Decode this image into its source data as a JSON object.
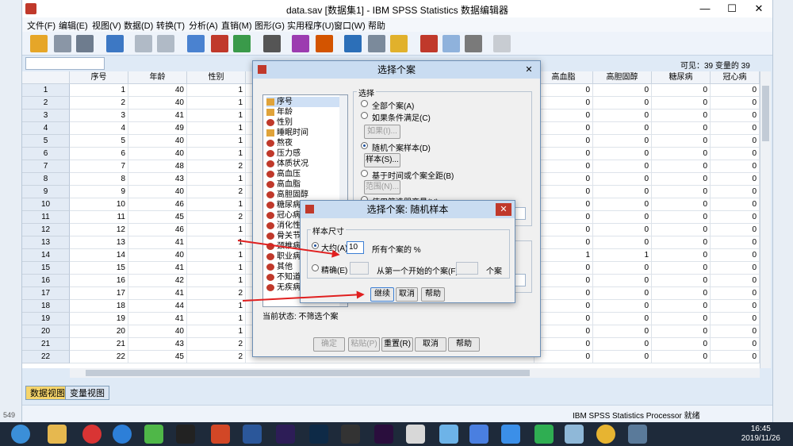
{
  "window": {
    "title": "data.sav [数据集1] - IBM SPSS Statistics 数据编辑器",
    "minimize": "—",
    "maximize": "☐",
    "close": "✕"
  },
  "menu": [
    "文件(F)",
    "编辑(E)",
    "视图(V)",
    "数据(D)",
    "转换(T)",
    "分析(A)",
    "直销(M)",
    "图形(G)",
    "实用程序(U)",
    "窗口(W)",
    "帮助"
  ],
  "visible_info": "可见：39 变量的 39",
  "columns": [
    "序号",
    "年龄",
    "性别",
    "高血脂",
    "高胆固醇",
    "糖尿病",
    "冠心病"
  ],
  "rows": [
    {
      "n": "1",
      "id": "1",
      "age": "40",
      "sex": "1",
      "hl": "0",
      "hc": "0",
      "db": "0",
      "chd": "0"
    },
    {
      "n": "2",
      "id": "2",
      "age": "40",
      "sex": "1",
      "hl": "0",
      "hc": "0",
      "db": "0",
      "chd": "0"
    },
    {
      "n": "3",
      "id": "3",
      "age": "41",
      "sex": "1",
      "hl": "0",
      "hc": "0",
      "db": "0",
      "chd": "0"
    },
    {
      "n": "4",
      "id": "4",
      "age": "49",
      "sex": "1",
      "hl": "0",
      "hc": "0",
      "db": "0",
      "chd": "0"
    },
    {
      "n": "5",
      "id": "5",
      "age": "40",
      "sex": "1",
      "hl": "0",
      "hc": "0",
      "db": "0",
      "chd": "0"
    },
    {
      "n": "6",
      "id": "6",
      "age": "40",
      "sex": "1",
      "hl": "0",
      "hc": "0",
      "db": "0",
      "chd": "0"
    },
    {
      "n": "7",
      "id": "7",
      "age": "48",
      "sex": "2",
      "hl": "0",
      "hc": "0",
      "db": "0",
      "chd": "0"
    },
    {
      "n": "8",
      "id": "8",
      "age": "43",
      "sex": "1",
      "hl": "0",
      "hc": "0",
      "db": "0",
      "chd": "0"
    },
    {
      "n": "9",
      "id": "9",
      "age": "40",
      "sex": "2",
      "hl": "0",
      "hc": "0",
      "db": "0",
      "chd": "0"
    },
    {
      "n": "10",
      "id": "10",
      "age": "46",
      "sex": "1",
      "hl": "0",
      "hc": "0",
      "db": "0",
      "chd": "0"
    },
    {
      "n": "11",
      "id": "11",
      "age": "45",
      "sex": "2",
      "hl": "0",
      "hc": "0",
      "db": "0",
      "chd": "0"
    },
    {
      "n": "12",
      "id": "12",
      "age": "46",
      "sex": "1",
      "hl": "0",
      "hc": "0",
      "db": "0",
      "chd": "0"
    },
    {
      "n": "13",
      "id": "13",
      "age": "41",
      "sex": "1",
      "hl": "0",
      "hc": "0",
      "db": "0",
      "chd": "0"
    },
    {
      "n": "14",
      "id": "14",
      "age": "40",
      "sex": "1",
      "hl": "1",
      "hc": "1",
      "db": "0",
      "chd": "0"
    },
    {
      "n": "15",
      "id": "15",
      "age": "41",
      "sex": "1",
      "hl": "0",
      "hc": "0",
      "db": "0",
      "chd": "0"
    },
    {
      "n": "16",
      "id": "16",
      "age": "42",
      "sex": "1",
      "hl": "0",
      "hc": "0",
      "db": "0",
      "chd": "0"
    },
    {
      "n": "17",
      "id": "17",
      "age": "41",
      "sex": "2",
      "hl": "0",
      "hc": "0",
      "db": "0",
      "chd": "0"
    },
    {
      "n": "18",
      "id": "18",
      "age": "44",
      "sex": "1",
      "hl": "0",
      "hc": "0",
      "db": "0",
      "chd": "0"
    },
    {
      "n": "19",
      "id": "19",
      "age": "41",
      "sex": "1",
      "hl": "0",
      "hc": "0",
      "db": "0",
      "chd": "0"
    },
    {
      "n": "20",
      "id": "20",
      "age": "40",
      "sex": "1",
      "hl": "0",
      "hc": "0",
      "db": "0",
      "chd": "0"
    },
    {
      "n": "21",
      "id": "21",
      "age": "43",
      "sex": "2",
      "hl": "0",
      "hc": "0",
      "db": "0",
      "chd": "0"
    },
    {
      "n": "22",
      "id": "22",
      "age": "45",
      "sex": "2",
      "hl": "0",
      "hc": "0",
      "db": "0",
      "chd": "0"
    }
  ],
  "view_tabs": {
    "data": "数据视图",
    "variable": "变量视图"
  },
  "status": "IBM SPSS Statistics Processor 就绪",
  "select_dialog": {
    "title": "选择个案",
    "group": "选择",
    "variables": [
      "序号",
      "年龄",
      "性别",
      "睡眠时间",
      "熬夜",
      "压力感",
      "体质状况",
      "高血压",
      "高血脂",
      "高胆固醇",
      "糖尿病",
      "冠心病",
      "消化性",
      "骨关节",
      "颈椎病",
      "职业病",
      "其他",
      "不知道",
      "无疾病"
    ],
    "opt_all": "全部个案(A)",
    "opt_if": "如果条件满足(C)",
    "btn_if": "如果(I)...",
    "opt_random": "随机个案样本(D)",
    "btn_sample": "样本(S)...",
    "opt_range": "基于时间或个案全距(B)",
    "btn_range": "范围(N)...",
    "opt_filter": "使用筛选器变量(U):",
    "current_status": "当前状态: 不筛选个案",
    "ok": "确定",
    "paste": "粘贴(P)",
    "reset": "重置(R)",
    "cancel": "取消",
    "help": "帮助"
  },
  "random_dialog": {
    "title": "选择个案: 随机样本",
    "group": "样本尺寸",
    "approx": "大约(A)",
    "percent_value": "10",
    "percent_suffix": "所有个案的 %",
    "exact": "精确(E)",
    "exact_middle": "从第一个开始的个案(F)",
    "exact_suffix": "个案",
    "continue": "继续",
    "cancel": "取消",
    "help": "帮助"
  },
  "taskbar": {
    "time": "16:45",
    "date": "2019/11/26"
  },
  "left_number": "549",
  "colors": {
    "accent": "#1c4f9c",
    "arrow": "#e02020",
    "titlebar": "#c9dcf1"
  }
}
